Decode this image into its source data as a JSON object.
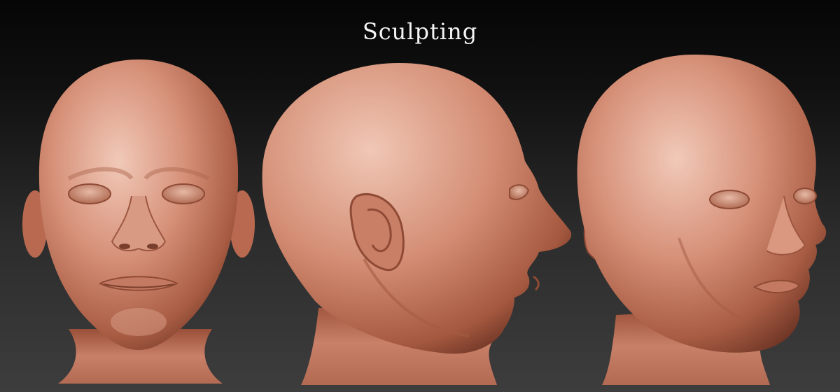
{
  "title": "Sculpting",
  "views": [
    {
      "id": "front"
    },
    {
      "id": "side"
    },
    {
      "id": "three-quarter"
    }
  ],
  "colors": {
    "clay_light": "#e9bba8",
    "clay_mid": "#c57d62",
    "clay_dark": "#7a3f2c",
    "background_top": "#060606",
    "background_bottom": "#3d3d3d",
    "title_text": "#f4f4f4"
  }
}
